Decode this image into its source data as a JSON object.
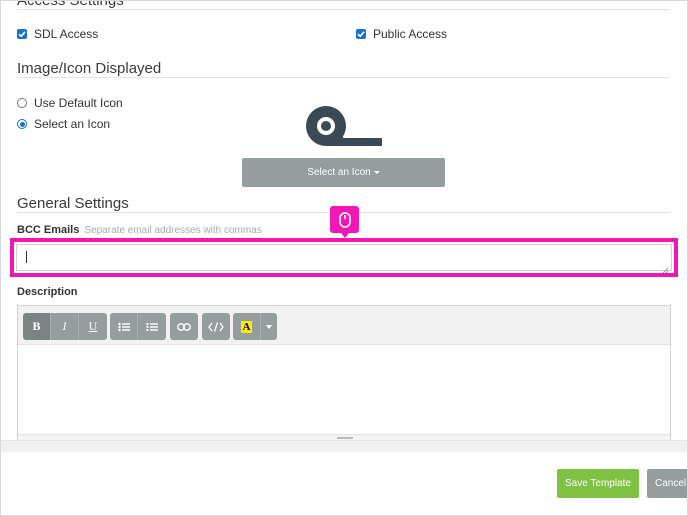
{
  "access_settings": {
    "title": "Access Settings",
    "sdl_access_label": "SDL Access",
    "sdl_access_checked": true,
    "public_access_label": "Public Access",
    "public_access_checked": true
  },
  "image_icon": {
    "title": "Image/Icon Displayed",
    "options": [
      {
        "label": "Use Default Icon",
        "selected": false
      },
      {
        "label": "Select an Icon",
        "selected": true
      }
    ],
    "preview_icon": "tape-roll-icon",
    "select_button_label": "Select an Icon"
  },
  "general_settings": {
    "title": "General Settings",
    "bcc_label": "BCC Emails",
    "bcc_hint": "Separate email addresses with commas",
    "bcc_value": "",
    "description_label": "Description"
  },
  "editor_toolbar": {
    "bold": "B",
    "italic": "I",
    "underline": "U",
    "color_letter": "A"
  },
  "footer": {
    "save_label": "Save Template",
    "cancel_label": "Cancel"
  },
  "colors": {
    "highlight": "#f018b6",
    "primary": "#1a73c7",
    "save": "#7fc241",
    "neutral_button": "#959d9d"
  }
}
